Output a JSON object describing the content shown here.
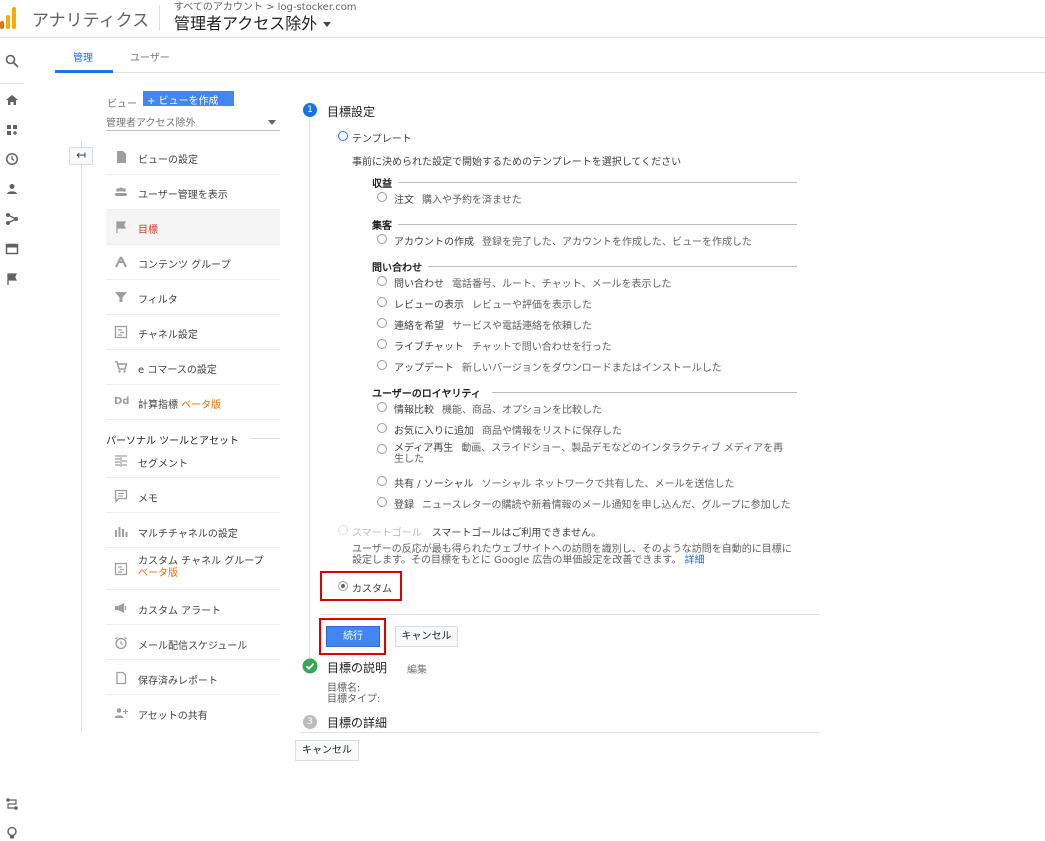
{
  "header": {
    "app_title": "アナリティクス",
    "breadcrumb_account": "すべてのアカウント > log-stocker.com",
    "view_name": "管理者アクセス除外"
  },
  "tabs": {
    "admin": "管理",
    "user": "ユーザー"
  },
  "view_panel": {
    "label": "ビュー",
    "create_button": "+ ビューを作成",
    "selected_view": "管理者アクセス除外"
  },
  "menu": {
    "items": [
      {
        "label": "ビューの設定",
        "icon": "doc-icon"
      },
      {
        "label": "ユーザー管理を表示",
        "icon": "people-icon"
      },
      {
        "label": "目標",
        "icon": "flag-icon"
      },
      {
        "label": "コンテンツ グループ",
        "icon": "content-group-icon"
      },
      {
        "label": "フィルタ",
        "icon": "filter-icon"
      },
      {
        "label": "チャネル設定",
        "icon": "channel-icon"
      },
      {
        "label": "e コマースの設定",
        "icon": "cart-icon"
      },
      {
        "label": "計算指標",
        "icon": "dd-icon",
        "beta": "ベータ版"
      }
    ],
    "personal_section": "パーソナル ツールとアセット",
    "personal_items": [
      {
        "label": "セグメント",
        "icon": "segment-icon"
      },
      {
        "label": "メモ",
        "icon": "note-icon"
      },
      {
        "label": "マルチチャネルの設定",
        "icon": "bar-chart-icon"
      },
      {
        "label": "カスタム チャネル グループ",
        "icon": "custom-channel-icon",
        "beta": "ベータ版"
      },
      {
        "label": "カスタム アラート",
        "icon": "megaphone-icon"
      },
      {
        "label": "メール配信スケジュール",
        "icon": "alarm-icon"
      },
      {
        "label": "保存済みレポート",
        "icon": "saved-report-icon"
      },
      {
        "label": "アセットの共有",
        "icon": "person-add-icon"
      }
    ]
  },
  "goal_setup": {
    "step1_num": "1",
    "step1_title": "目標設定",
    "template_label": "テンプレート",
    "template_desc": "事前に決められた設定で開始するためのテンプレートを選択してください",
    "categories": [
      {
        "name": "収益",
        "options": [
          {
            "name": "注文",
            "desc": "購入や予約を済ませた"
          }
        ]
      },
      {
        "name": "集客",
        "options": [
          {
            "name": "アカウントの作成",
            "desc": "登録を完了した、アカウントを作成した、ビューを作成した"
          }
        ]
      },
      {
        "name": "問い合わせ",
        "options": [
          {
            "name": "問い合わせ",
            "desc": "電話番号、ルート、チャット、メールを表示した"
          },
          {
            "name": "レビューの表示",
            "desc": "レビューや評価を表示した"
          },
          {
            "name": "連絡を希望",
            "desc": "サービスや電話連絡を依頼した"
          },
          {
            "name": "ライブチャット",
            "desc": "チャットで問い合わせを行った"
          },
          {
            "name": "アップデート",
            "desc": "新しいバージョンをダウンロードまたはインストールした"
          }
        ]
      },
      {
        "name": "ユーザーのロイヤリティ",
        "options": [
          {
            "name": "情報比較",
            "desc": "機能、商品、オプションを比較した"
          },
          {
            "name": "お気に入りに追加",
            "desc": "商品や情報をリストに保存した"
          },
          {
            "name": "メディア再生",
            "desc": "動画、スライドショー、製品デモなどのインタラクティブ メディアを再",
            "desc2": "生した"
          },
          {
            "name": "共有 / ソーシャル",
            "desc": "ソーシャル ネットワークで共有した、メールを送信した"
          },
          {
            "name": "登録",
            "desc": "ニュースレターの購読や新着情報のメール通知を申し込んだ、グループに参加した"
          }
        ]
      }
    ],
    "smart_goal_label": "スマートゴール",
    "smart_goal_status": "スマートゴールはご利用できません。",
    "smart_goal_desc1": "ユーザーの反応が最も得られたウェブサイトへの訪問を識別し、そのような訪問を自動的に目標に",
    "smart_goal_desc2": "設定します。その目標をもとに Google 広告の単価設定を改善できます。",
    "smart_goal_link": "詳細",
    "custom_label": "カスタム",
    "continue_button": "続行",
    "cancel_button": "キャンセル",
    "step2_title": "目標の説明",
    "step2_edit": "編集",
    "goal_name_label": "目標名:",
    "goal_type_label": "目標タイプ:",
    "step3_num": "3",
    "step3_title": "目標の詳細",
    "bottom_cancel": "キャンセル"
  },
  "colors": {
    "accent": "#1a73e8",
    "primary_button": "#4285f4",
    "highlight": "#e00000",
    "active_menu": "#d23f31",
    "beta": "#e8710a",
    "done": "#34a853"
  }
}
